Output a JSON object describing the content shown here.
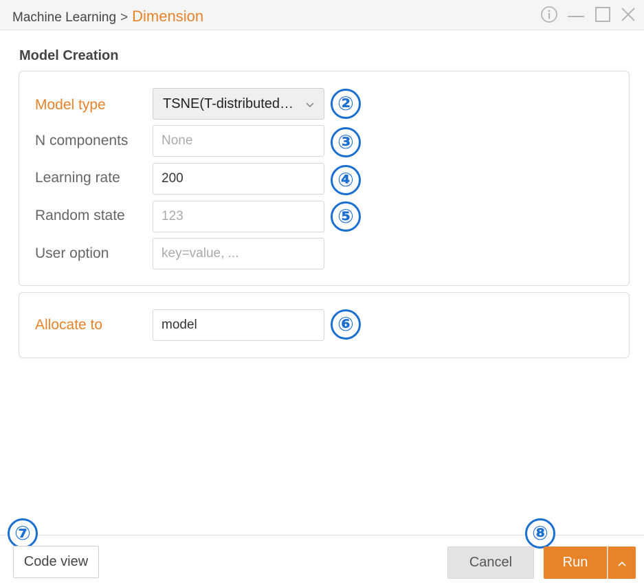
{
  "breadcrumb": {
    "parent": "Machine Learning",
    "separator": ">",
    "current": "Dimension"
  },
  "section": {
    "title": "Model Creation"
  },
  "form": {
    "model_type": {
      "label": "Model type",
      "value": "TSNE(T-distributed…"
    },
    "n_components": {
      "label": "N components",
      "placeholder": "None"
    },
    "learning_rate": {
      "label": "Learning rate",
      "value": "200"
    },
    "random_state": {
      "label": "Random state",
      "placeholder": "123"
    },
    "user_option": {
      "label": "User option",
      "placeholder": "key=value, ..."
    }
  },
  "allocate": {
    "label": "Allocate to",
    "value": "model"
  },
  "markers": [
    "②",
    "③",
    "④",
    "⑤",
    "⑥",
    "⑦",
    "⑧"
  ],
  "footer": {
    "code_view": "Code view",
    "cancel": "Cancel",
    "run": "Run"
  },
  "icons": {
    "info": "info-icon",
    "minimize": "minimize-icon",
    "maximize": "maximize-icon",
    "close": "close-icon",
    "chevron_down": "chevron-down-icon",
    "chevron_up": "chevron-up-icon"
  },
  "colors": {
    "accent": "#e8832a",
    "marker": "#1a6fd1"
  }
}
